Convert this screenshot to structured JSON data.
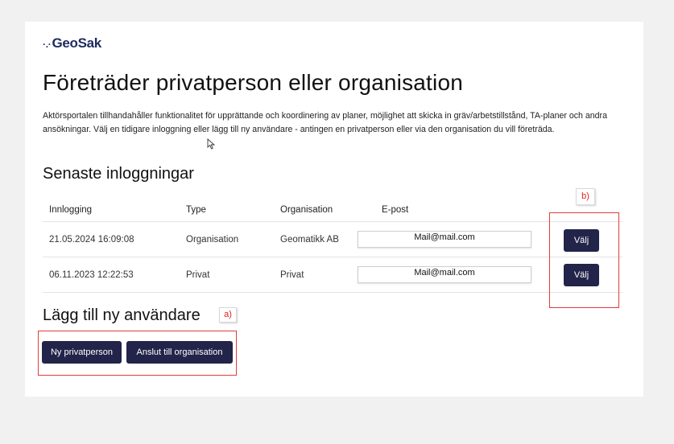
{
  "brand": {
    "dots": "·.·",
    "name": "GeoSak"
  },
  "page_title": "Företräder privatperson eller organisation",
  "description": "Aktörsportalen tillhandahåller funktionalitet för upprättande och koordinering av planer, möjlighet att skicka in gräv/arbetstillstånd, TA-planer och andra ansökningar. Välj en tidigare inloggning eller lägg till ny användare - antingen en privatperson eller via den organisation du vill företräda.",
  "recent": {
    "heading": "Senaste inloggningar",
    "columns": [
      "Innlogging",
      "Type",
      "Organisation",
      "E-post"
    ],
    "rows": [
      {
        "login": "21.05.2024 16:09:08",
        "type": "Organisation",
        "org": "Geomatikk AB",
        "email": "Mail@mail.com",
        "action": "Välj"
      },
      {
        "login": "06.11.2023 12:22:53",
        "type": "Privat",
        "org": "Privat",
        "email": "Mail@mail.com",
        "action": "Välj"
      }
    ]
  },
  "add_user": {
    "heading": "Lägg till ny användare",
    "btn_private": "Ny privatperson",
    "btn_org": "Anslut till organisation"
  },
  "annotations": {
    "a": "a)",
    "b": "b)"
  },
  "colors": {
    "primary": "#23244a",
    "brand": "#1e2a5e",
    "annotation": "#e53a3a",
    "background": "#f1f1f1"
  },
  "icons": {
    "cursor": "mouse-pointer-icon"
  }
}
